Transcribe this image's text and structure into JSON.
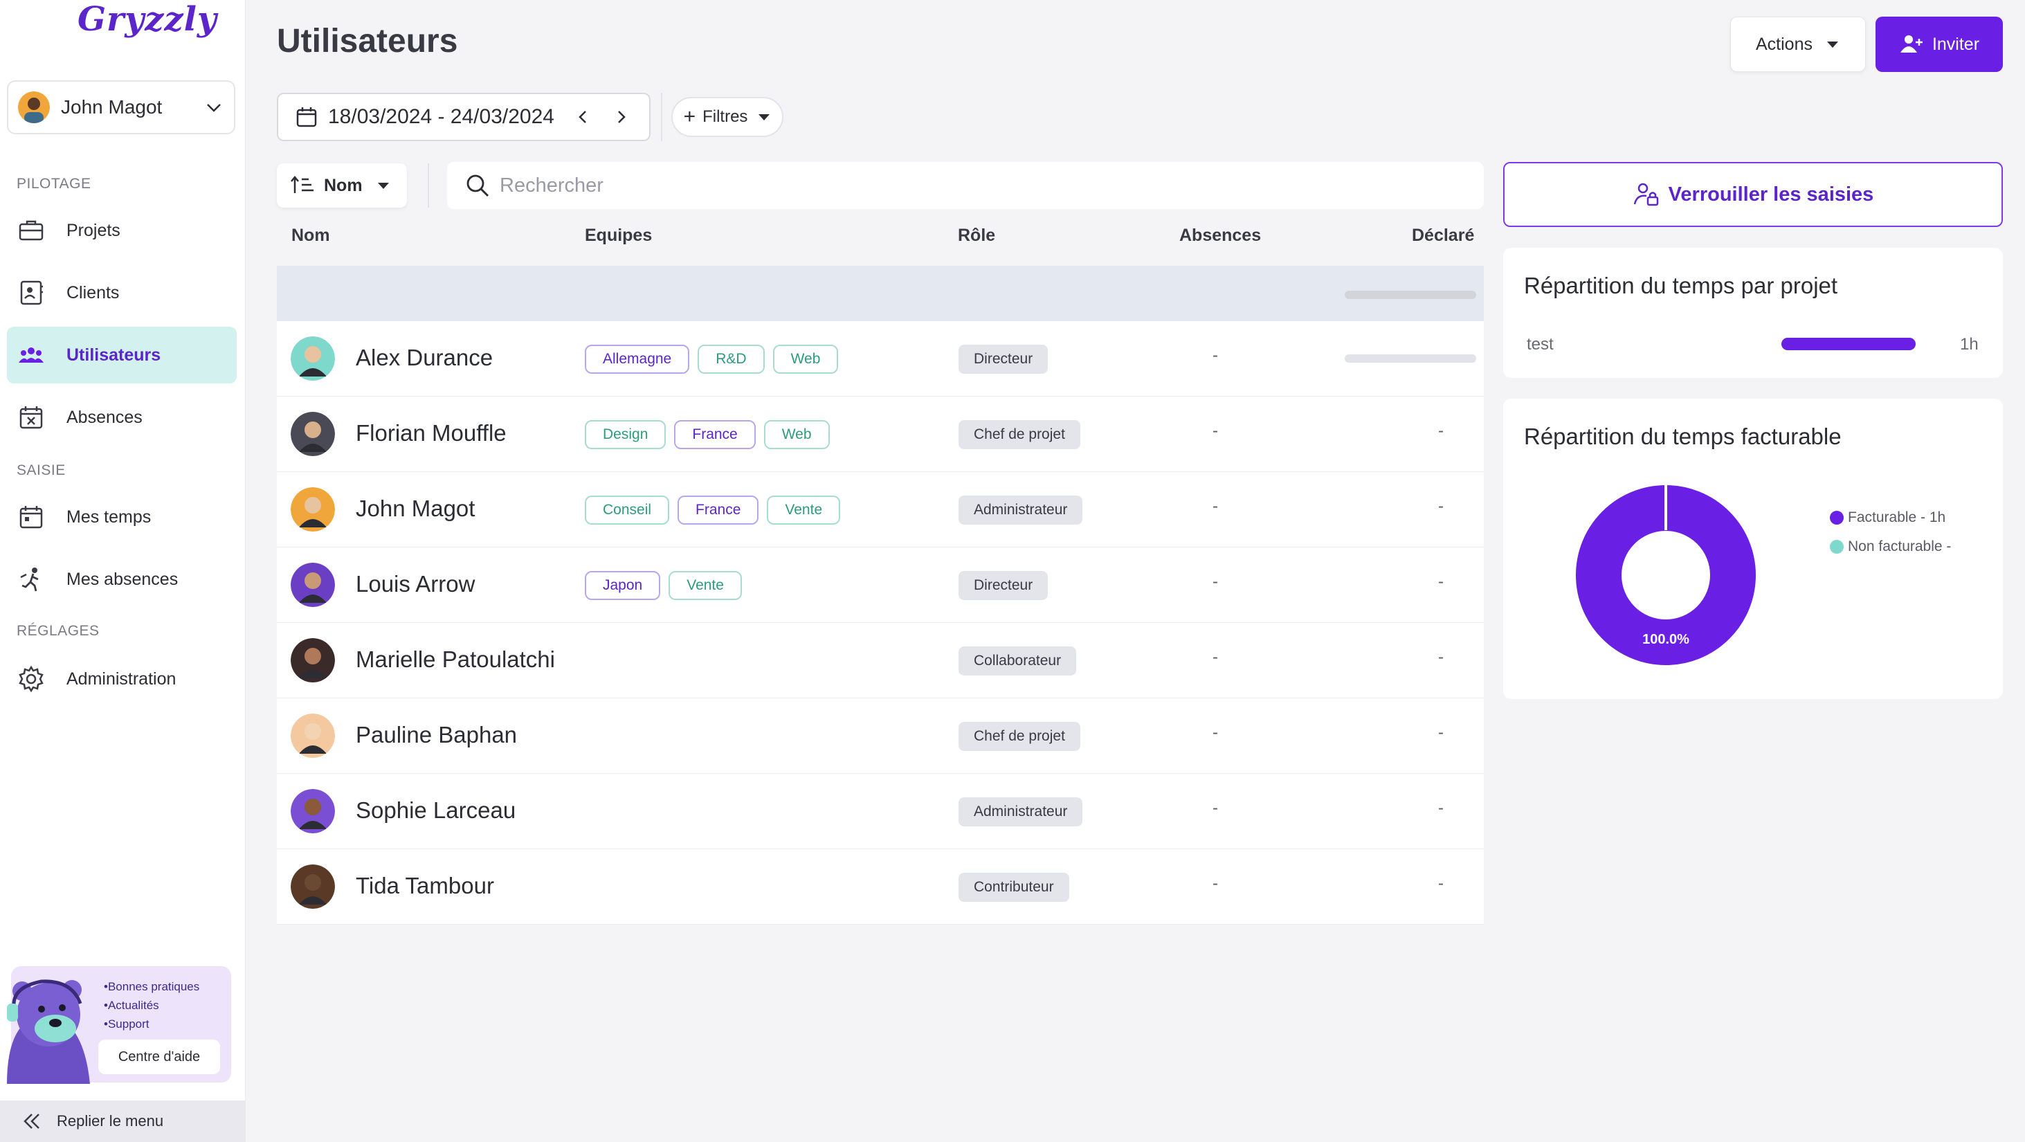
{
  "app": {
    "logo_text": "Gryzzly"
  },
  "colors": {
    "accent": "#6a1fe4",
    "accent_dark": "#5b25c9",
    "active_nav_bg": "#d3f2ef",
    "non_billable": "#7fd8cc"
  },
  "sidebar": {
    "user_name": "John Magot",
    "sections": {
      "pilotage": "PILOTAGE",
      "saisie": "SAISIE",
      "reglages": "RÉGLAGES"
    },
    "items": [
      {
        "label": "Projets",
        "icon": "briefcase-icon"
      },
      {
        "label": "Clients",
        "icon": "contact-card-icon"
      },
      {
        "label": "Utilisateurs",
        "icon": "users-icon",
        "active": true
      },
      {
        "label": "Absences",
        "icon": "calendar-x-icon"
      },
      {
        "label": "Mes temps",
        "icon": "calendar-icon"
      },
      {
        "label": "Mes absences",
        "icon": "beach-icon"
      },
      {
        "label": "Administration",
        "icon": "gear-icon"
      }
    ],
    "help": {
      "bullets": [
        "•Bonnes pratiques",
        "•Actualités",
        "•Support"
      ],
      "button": "Centre d'aide"
    },
    "collapse_label": "Replier le menu"
  },
  "header": {
    "title": "Utilisateurs",
    "actions_label": "Actions",
    "invite_label": "Inviter"
  },
  "toolbar": {
    "date_range": "18/03/2024 - 24/03/2024",
    "filters_label": "Filtres",
    "sort_label": "Nom",
    "search_placeholder": "Rechercher"
  },
  "table": {
    "columns": [
      "Nom",
      "Equipes",
      "Rôle",
      "Absences",
      "Déclaré"
    ],
    "rows": [
      {
        "name": "Alex Durance",
        "teams": [
          {
            "t": "Allemagne",
            "c": "p"
          },
          {
            "t": "R&D",
            "c": "g"
          },
          {
            "t": "Web",
            "c": "g"
          }
        ],
        "role": "Directeur",
        "absences": "-",
        "declared": ""
      },
      {
        "name": "Florian Mouffle",
        "teams": [
          {
            "t": "Design",
            "c": "g"
          },
          {
            "t": "France",
            "c": "p"
          },
          {
            "t": "Web",
            "c": "g"
          }
        ],
        "role": "Chef de projet",
        "absences": "-",
        "declared": "-"
      },
      {
        "name": "John Magot",
        "teams": [
          {
            "t": "Conseil",
            "c": "g"
          },
          {
            "t": "France",
            "c": "p"
          },
          {
            "t": "Vente",
            "c": "g"
          }
        ],
        "role": "Administrateur",
        "absences": "-",
        "declared": "-"
      },
      {
        "name": "Louis Arrow",
        "teams": [
          {
            "t": "Japon",
            "c": "p"
          },
          {
            "t": "Vente",
            "c": "g"
          }
        ],
        "role": "Directeur",
        "absences": "-",
        "declared": "-"
      },
      {
        "name": "Marielle Patoulatchi",
        "teams": [],
        "role": "Collaborateur",
        "absences": "-",
        "declared": "-"
      },
      {
        "name": "Pauline Baphan",
        "teams": [],
        "role": "Chef de projet",
        "absences": "-",
        "declared": "-"
      },
      {
        "name": "Sophie Larceau",
        "teams": [],
        "role": "Administrateur",
        "absences": "-",
        "declared": "-"
      },
      {
        "name": "Tida Tambour",
        "teams": [],
        "role": "Contributeur",
        "absences": "-",
        "declared": "-"
      }
    ]
  },
  "panel": {
    "lock_label": "Verrouiller les saisies",
    "project_card": {
      "title": "Répartition du temps par projet",
      "project": "test",
      "value": "1h"
    },
    "billable_card": {
      "title": "Répartition du temps facturable",
      "percent_label": "100.0%",
      "billable_fraction": 1.0,
      "legend": [
        "Facturable - 1h",
        "Non facturable -"
      ]
    }
  }
}
